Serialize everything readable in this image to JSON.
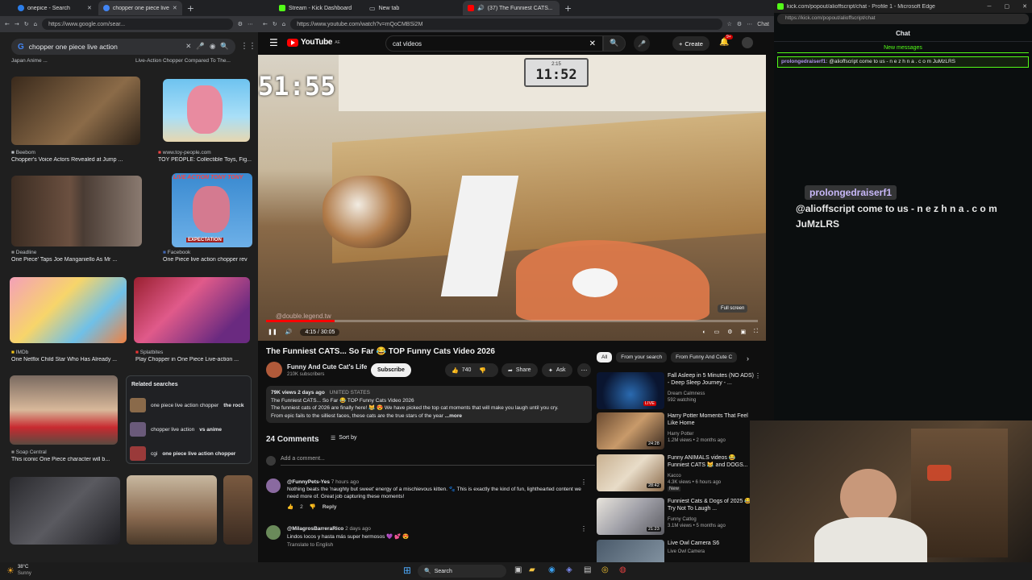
{
  "left": {
    "tabs": [
      {
        "label": "onepice - Search"
      },
      {
        "label": "chopper one piece live a"
      }
    ],
    "url": "https://www.google.com/sear...",
    "search_value": "chopper one piece live action",
    "top_caption_left": "Japan Anime ...",
    "top_caption_right": "Live-Action Chopper Compared To The...",
    "results": [
      {
        "source": "Beebom",
        "title": "Chopper's Voice Actors Revealed at Jump ..."
      },
      {
        "source": "www.toy-people.com",
        "title": "TOY PEOPLE: Collectible Toys, Fig..."
      },
      {
        "source": "Deadline",
        "title": "One Piece' Taps Joe Manganiello As Mr ..."
      },
      {
        "source": "Facebook",
        "title": "One Piece live action chopper rev"
      },
      {
        "source": "IMDb",
        "title": "One Netflix Child Star Who Has Already ..."
      },
      {
        "source": "Splatbites",
        "title": "Play Chopper in One Piece Live-action ..."
      },
      {
        "source": "Soap Central",
        "title": "This iconic One Piece character will b..."
      }
    ],
    "live_action_label": "LIVE ACTION TONY TONY",
    "expectation_label": "EXPECTATION",
    "related_title": "Related searches",
    "related": [
      {
        "prefix": "one piece live action chopper",
        "bold": "the rock"
      },
      {
        "prefix": "chopper live action",
        "bold": "vs anime"
      },
      {
        "prefix": "cgi",
        "bold": "one piece live action chopper"
      }
    ]
  },
  "mid": {
    "tabs": [
      {
        "label": "Stream - Kick Dashboard"
      },
      {
        "label": "New tab"
      },
      {
        "label": "(37) The Funniest CATS... So F"
      }
    ],
    "url": "https://www.youtube.com/watch?v=mQoCMBSi2M",
    "youtube_logo": "YouTube",
    "youtube_region": "AE",
    "search_value": "cat videos",
    "create_label": "Create",
    "notif_count": "9+",
    "video_timer": "51:55",
    "clock_text": "11:52",
    "clock_small": "2:15",
    "video_time": "4:15 / 30:05",
    "watermark": "@double.legend.tw",
    "tooltip": "Full screen",
    "progress": 0.14,
    "title": "The Funniest CATS... So Far 😂 TOP Funny Cats Video 2026",
    "channel": "Funny And Cute Cat's Life",
    "subscribers": "210K subscribers",
    "subscribe_label": "Subscribe",
    "likes": "740",
    "share_label": "Share",
    "ask_label": "Ask",
    "views_line": "79K views  2 days ago",
    "country": "UNITED STATES",
    "desc_title": "The Funniest CATS... So Far 😂 TOP Funny Cats Video 2026",
    "desc_text": "The funniest cats of 2026 are finally here! 😹 😍 We have picked the top cat moments that will make you laugh until you cry.",
    "desc_text2": "From epic fails to the silliest faces, these cats are the true stars of the year",
    "more_label": "...more",
    "comments_count": "24 Comments",
    "sort_label": "Sort by",
    "add_comment": "Add a comment...",
    "comments": [
      {
        "author": "@FunnyPets-Yes",
        "time": "7 hours ago",
        "text": "Nothing beats the 'naughty but sweet' energy of a mischievous kitten. 🐾 This is exactly the kind of fun, lighthearted content we need more of. Great job capturing these moments!",
        "likes": "2",
        "reply": "Reply"
      },
      {
        "author": "@MilagrosBarreraRico",
        "time": "2 days ago",
        "text": "Lindos locos y hasta más super hermosos 💜 💕 😍",
        "translate": "Translate to English"
      }
    ],
    "chips": [
      {
        "label": "All"
      },
      {
        "label": "From your search"
      },
      {
        "label": "From Funny And Cute C"
      }
    ],
    "recs": [
      {
        "title": "Fall Asleep in 5 Minutes (NO ADS) - Deep Sleep Journey - ...",
        "channel": "Dream Calmness",
        "meta": "592 watching",
        "badge": "LIVE"
      },
      {
        "title": "Harry Potter Moments That Feel Like Home",
        "channel": "Harry Potter",
        "meta": "1.2M views • 2 months ago",
        "badge": "24:28"
      },
      {
        "title": "Funny ANIMALS videos 😂 Funniest CATS 😹 and DOGS...",
        "channel": "Kacco",
        "meta": "4.3K views • 6 hours ago",
        "badge": "28:42",
        "extra": "New"
      },
      {
        "title": "Funniest Cats & Dogs of 2025 😂 | Try Not To Laugh ...",
        "channel": "Funny Catlog",
        "meta": "3.1M views • 5 months ago",
        "badge": "21:23"
      },
      {
        "title": "Live Owl Camera S6",
        "channel": "Live Owl Camera",
        "meta": "",
        "badge": ""
      }
    ]
  },
  "right": {
    "window_title": "kick.com/popout/alioffscript/chat - Profile 1 - Microsoft Edge",
    "url": "https://kick.com/popout/alioffscript/chat",
    "chat_title": "Chat",
    "new_messages": "New messages",
    "small_msg_user": "prolongedraiserf1:",
    "small_msg_text": "@alioffscript come to us - n e z h n a . c o m JuMzLRS",
    "big_user": "prolongedraiserf1",
    "big_msg_line1": "@alioffscript come to us - n e z h n a . c o m",
    "big_msg_line2": "JuMzLRS"
  },
  "taskbar": {
    "temp": "38°C",
    "weather": "Sunny",
    "search_label": "Search"
  },
  "colors": {
    "youtube_red": "#ff0000",
    "kick_green": "#53fc18",
    "chat_user": "#b191f2"
  }
}
